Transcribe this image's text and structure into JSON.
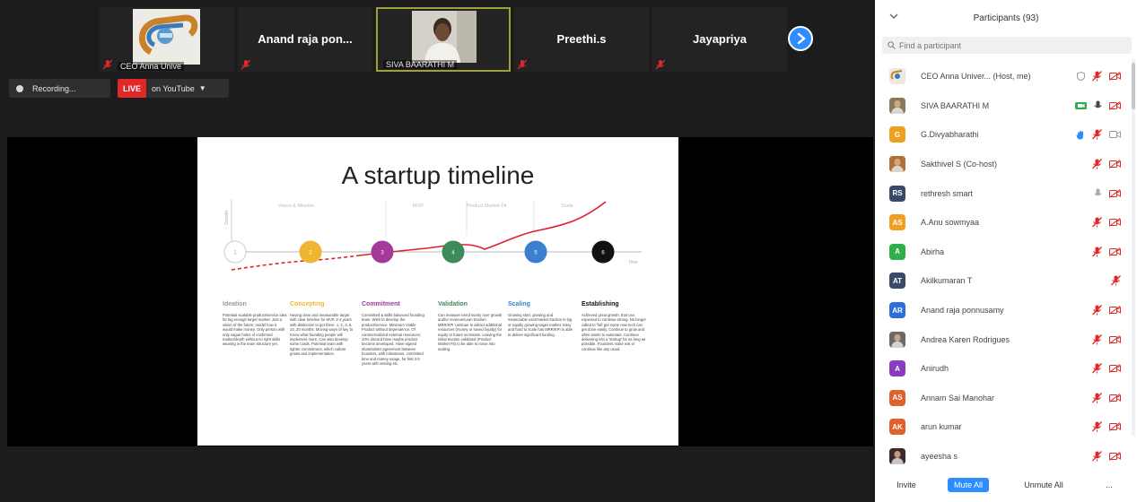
{
  "thumbnails": [
    {
      "type": "logo",
      "label": "CEO Anna Unive",
      "active": false
    },
    {
      "type": "name",
      "name": "Anand raja pon...",
      "active": false
    },
    {
      "type": "video",
      "label": "SIVA BAARATHI M",
      "active": true
    },
    {
      "type": "name",
      "name": "Preethi.s",
      "active": false
    },
    {
      "type": "name",
      "name": "Jayapriya",
      "active": false
    }
  ],
  "recording": {
    "label": "Recording..."
  },
  "live": {
    "badge": "LIVE",
    "platform": "on YouTube"
  },
  "slide": {
    "title": "A startup timeline",
    "axis_y": "Growth",
    "axis_x": "Time",
    "stage_labels": [
      "Vision & Mission",
      "MVP",
      "Product Market Fit",
      "Scale"
    ],
    "phases": [
      {
        "name": "Ideation",
        "color": "#c7c7c7",
        "step": "1",
        "text": "Potential scalable product/service idea for big enough target market. Just a vision of the future; model how it would make money. Only person with only vague holes of confirmed market/depth without no right skills wearing in the team structure yet."
      },
      {
        "name": "Concepting",
        "color": "#f0b633",
        "step": "2",
        "text": "Having clear and measurable target with clear timeline for MVP. 2-3 years with distinction to get there. 1, 2, 3, 5, 10, 20 months. Moving ways of key to Know what founding people will implement more. Can also develop some cards. Potential team with tighter commitment, which culture grows and implementation."
      },
      {
        "name": "Commitment",
        "color": "#a33a9a",
        "step": "3",
        "text": "Committed & skills balanced founding team. Wish to develop the product/service. Minimum Viable Product without dependence. Of commercialized external resources; 10% discard have maybe product become developed. Have signed shareholder agreement between founders, with milestones, committed time and money usage, for first 3-5 years with vesting etc."
      },
      {
        "name": "Validation",
        "color": "#3f8a5a",
        "step": "4",
        "text": "Can measure trend surely over growth and/or revenue/Lean traction. MRR/KPI continue to attract additional resources (money or saved loyalty) for equity or future increases. Leaving the initial traction validated (Product Market Fit) to be able to move into scaling."
      },
      {
        "name": "Scaling",
        "color": "#3a7fd0",
        "step": "5",
        "text": "Growing start, growing and measurable user/market traction in big or rapidly growing target market. Easy and hard to scale has MRR/KPI is able to deliver significant funding."
      },
      {
        "name": "Establishing",
        "color": "#111111",
        "step": "6",
        "text": "Achieved great growth, that can expected to continue strong. No longer called to 'fail' get some new tech can get done easily. Continue to grow and often wants to automate. Continue delivering into a 'startup' for as long as possible. Founders make exit or continue like any usual."
      }
    ]
  },
  "panel": {
    "title": "Participants (93)",
    "search_placeholder": "Find a participant",
    "participants": [
      {
        "name": "CEO Anna Univer... (Host, me)",
        "avatar_type": "logo",
        "initials": "",
        "color": "#ece9e2",
        "video": false,
        "audio": "muted",
        "extra": "shield-icon"
      },
      {
        "name": "SIVA BAARATHI M",
        "avatar_type": "photo",
        "initials": "",
        "color": "#8a7a5a",
        "video": true,
        "audio": "on",
        "extra": ""
      },
      {
        "name": "G.Divyabharathi",
        "avatar_type": "initials",
        "initials": "G",
        "color": "#f0a020",
        "video": false,
        "audio": "muted",
        "extra": "raise-hand-icon"
      },
      {
        "name": "Sakthivel S (Co-host)",
        "avatar_type": "photo",
        "initials": "",
        "color": "#b0703a",
        "video": false,
        "audio": "muted",
        "extra": ""
      },
      {
        "name": "rethresh smart",
        "avatar_type": "initials",
        "initials": "RS",
        "color": "#3a4a66",
        "video": false,
        "audio": "on",
        "extra": ""
      },
      {
        "name": "A.Anu sowmyaa",
        "avatar_type": "initials",
        "initials": "AS",
        "color": "#f0a020",
        "video": false,
        "audio": "muted",
        "extra": ""
      },
      {
        "name": "Abirha",
        "avatar_type": "initials",
        "initials": "A",
        "color": "#2fae4a",
        "video": false,
        "audio": "muted",
        "extra": ""
      },
      {
        "name": "Akilkumaran T",
        "avatar_type": "initials",
        "initials": "AT",
        "color": "#3a4a66",
        "video": false,
        "audio": "muted-only",
        "extra": ""
      },
      {
        "name": "Anand raja ponnusamy",
        "avatar_type": "initials",
        "initials": "AR",
        "color": "#2d6fd8",
        "video": false,
        "audio": "muted",
        "extra": ""
      },
      {
        "name": "Andrea Karen Rodrigues",
        "avatar_type": "photo",
        "initials": "",
        "color": "#6a6a6a",
        "video": false,
        "audio": "muted",
        "extra": ""
      },
      {
        "name": "Anirudh",
        "avatar_type": "initials",
        "initials": "A",
        "color": "#8a3cc0",
        "video": false,
        "audio": "muted",
        "extra": ""
      },
      {
        "name": "Annam Sai Manohar",
        "avatar_type": "initials",
        "initials": "AS",
        "color": "#e0602a",
        "video": false,
        "audio": "muted",
        "extra": ""
      },
      {
        "name": "arun kumar",
        "avatar_type": "initials",
        "initials": "AK",
        "color": "#e0602a",
        "video": false,
        "audio": "muted",
        "extra": ""
      },
      {
        "name": "ayeesha s",
        "avatar_type": "photo",
        "initials": "",
        "color": "#3a2a2a",
        "video": false,
        "audio": "muted",
        "extra": ""
      }
    ],
    "footer": {
      "invite": "Invite",
      "mute_all": "Mute All",
      "unmute_all": "Unmute All",
      "more": "..."
    }
  },
  "colors": {
    "accent": "#2d8cff",
    "muted_red": "#e02828",
    "live_red": "#e02828",
    "timeline_red": "#e0202a"
  }
}
